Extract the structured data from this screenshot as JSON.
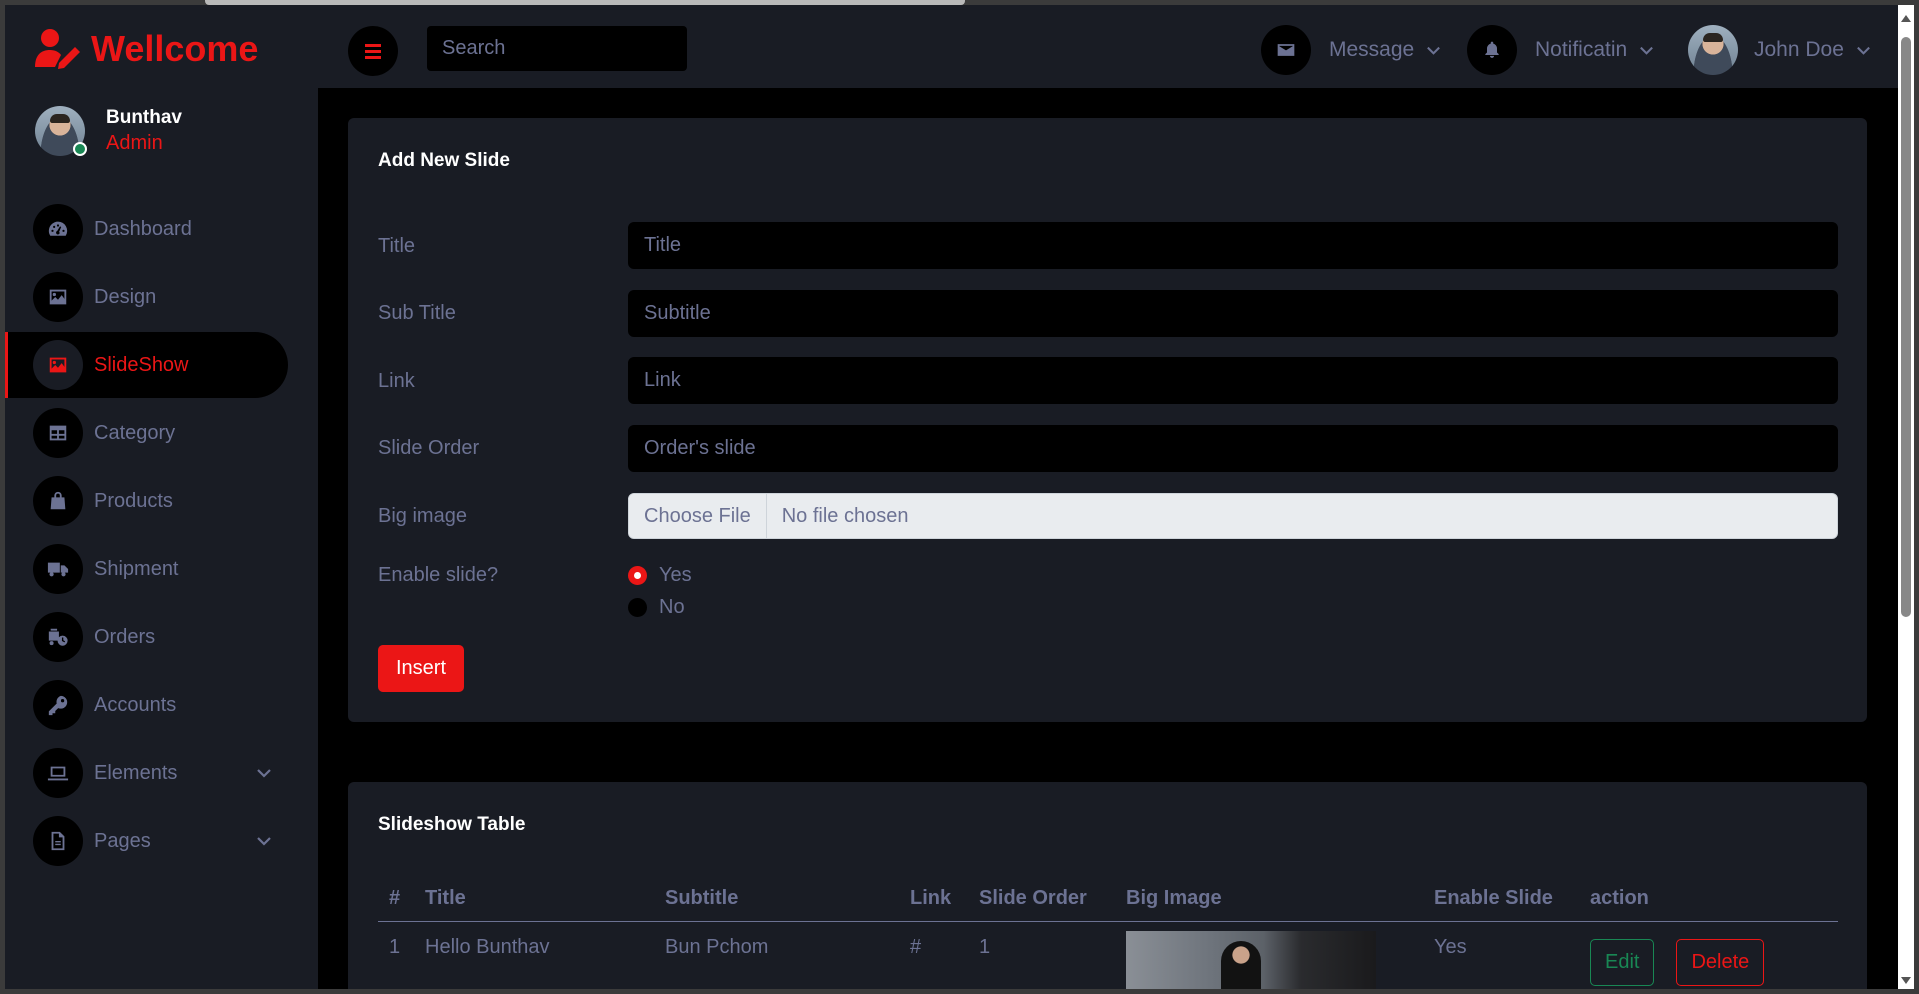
{
  "brand": {
    "title": "Wellcome",
    "color": "#eb1616"
  },
  "profile": {
    "name": "Bunthav",
    "role": "Admin"
  },
  "sidebar": {
    "items": [
      {
        "label": "Dashboard",
        "icon": "gauge-icon"
      },
      {
        "label": "Design",
        "icon": "image-icon"
      },
      {
        "label": "SlideShow",
        "icon": "image-icon",
        "active": true
      },
      {
        "label": "Category",
        "icon": "table-icon"
      },
      {
        "label": "Products",
        "icon": "shopping-bag-icon"
      },
      {
        "label": "Shipment",
        "icon": "truck-icon"
      },
      {
        "label": "Orders",
        "icon": "truck-clock-icon"
      },
      {
        "label": "Accounts",
        "icon": "key-icon"
      },
      {
        "label": "Elements",
        "icon": "laptop-icon",
        "has_submenu": true
      },
      {
        "label": "Pages",
        "icon": "file-icon",
        "has_submenu": true
      }
    ]
  },
  "topbar": {
    "search_placeholder": "Search",
    "message_label": "Message",
    "notification_label": "Notificatin",
    "user_label": "John Doe"
  },
  "form": {
    "title": "Add New Slide",
    "fields": [
      {
        "label": "Title",
        "placeholder": "Title"
      },
      {
        "label": "Sub Title",
        "placeholder": "Subtitle"
      },
      {
        "label": "Link",
        "placeholder": "Link"
      },
      {
        "label": "Slide Order",
        "placeholder": "Order's slide"
      }
    ],
    "big_image_label": "Big image",
    "file_button": "Choose File",
    "file_status": "No file chosen",
    "enable_label": "Enable slide?",
    "radio_yes": "Yes",
    "radio_no": "No",
    "selected": "Yes",
    "insert_button": "Insert"
  },
  "table": {
    "title": "Slideshow Table",
    "headers": [
      "#",
      "Title",
      "Subtitle",
      "Link",
      "Slide Order",
      "Big Image",
      "Enable Slide",
      "action"
    ],
    "rows": [
      {
        "num": "1",
        "title": "Hello Bunthav",
        "subtitle": "Bun Pchom",
        "link": "#",
        "order": "1",
        "enable": "Yes",
        "edit": "Edit",
        "delete": "Delete"
      }
    ]
  },
  "colors": {
    "accent": "#eb1616",
    "panel": "#191c24",
    "muted": "#6c7293",
    "success": "#198754"
  }
}
